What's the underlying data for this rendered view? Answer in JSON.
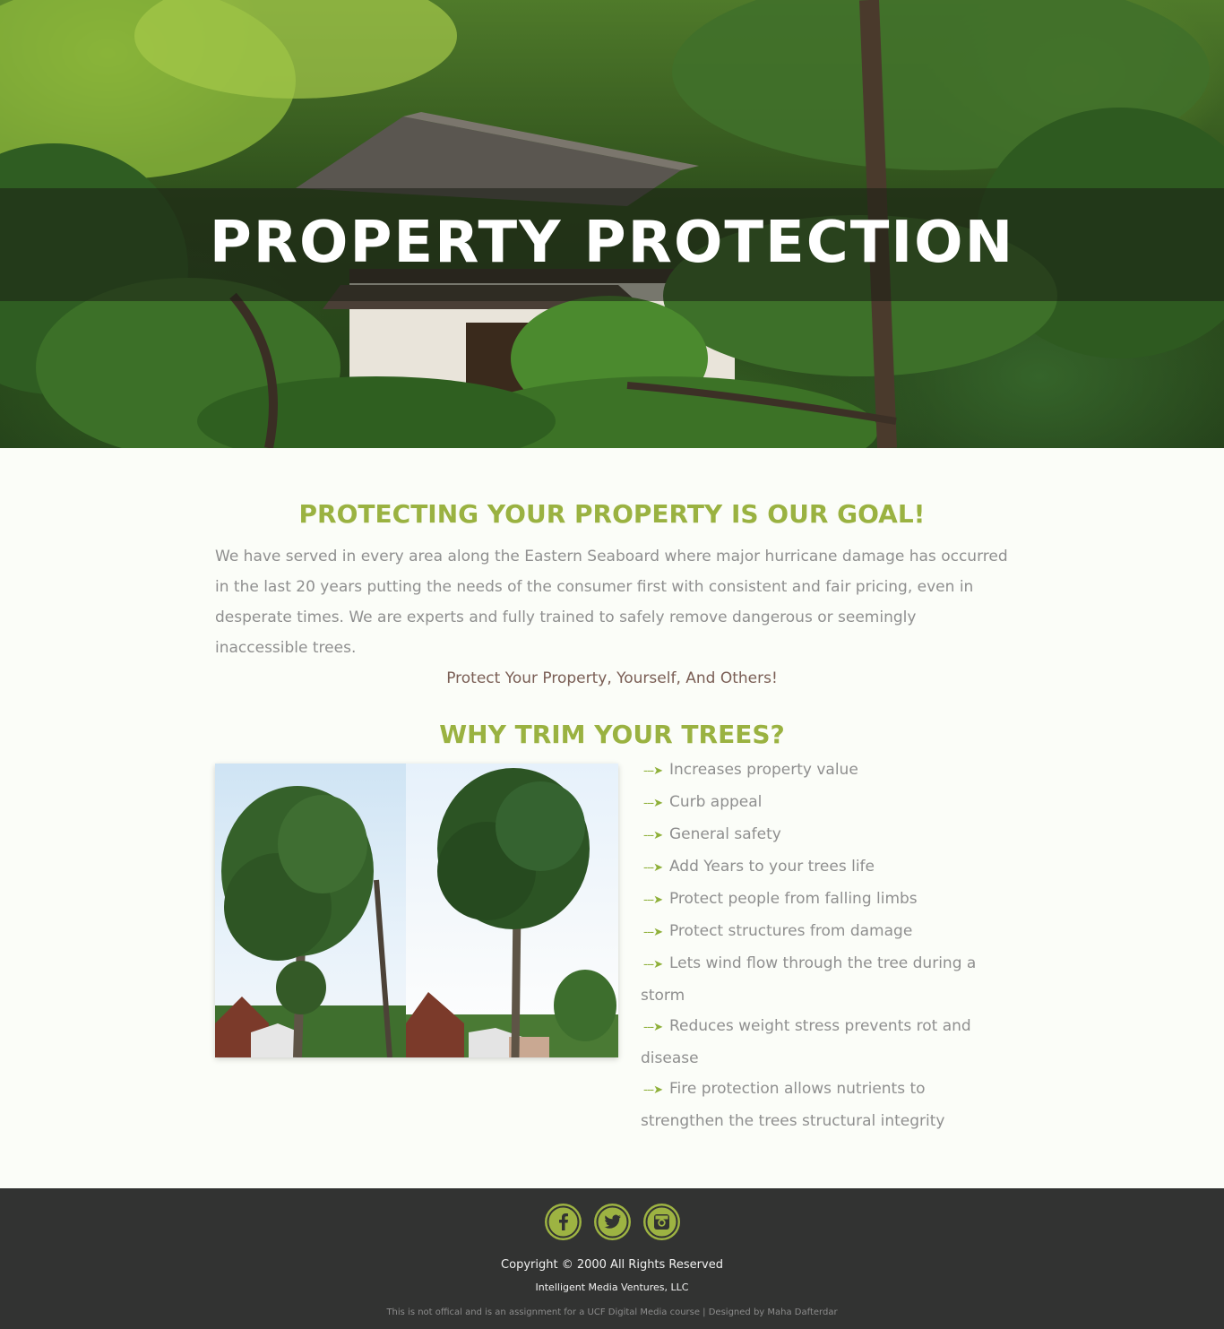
{
  "hero": {
    "title": "PROPERTY PROTECTION"
  },
  "goal": {
    "heading": "PROTECTING YOUR PROPERTY IS OUR GOAL!",
    "paragraph": "We have served in every area along the Eastern Seaboard where major hurricane damage has occurred in the last 20 years putting the needs of the consumer first with consistent and fair pricing, even in desperate times. We are experts and fully trained to safely remove dangerous or seemingly inaccessible trees.",
    "tagline": "Protect Your Property, Yourself, And Others!"
  },
  "why": {
    "heading": "WHY TRIM YOUR TREES?",
    "arrow": "---➤",
    "items": [
      "Increases property value",
      "Curb appeal",
      "General safety",
      "Add Years to your trees life",
      "Protect people from falling limbs",
      "Protect structures from damage",
      "Lets wind flow through the tree during a storm",
      "Reduces weight stress prevents rot and disease",
      "Fire protection allows nutrients to strengthen the trees structural integrity"
    ]
  },
  "footer": {
    "social": [
      {
        "icon": "facebook-icon",
        "glyph": "f"
      },
      {
        "icon": "twitter-icon",
        "glyph": "bird"
      },
      {
        "icon": "instagram-icon",
        "glyph": "camera"
      }
    ],
    "copyright": "Copyright © 2000 All Rights Reserved",
    "company": "Intelligent Media Ventures, LLC",
    "disclaimer": "This is not offical and is an assignment for a UCF Digital Media course | Designed by Maha Dafterdar"
  },
  "colors": {
    "accent": "#9ab241",
    "footer_bg": "#323332",
    "page_bg": "#fbfdf8"
  }
}
